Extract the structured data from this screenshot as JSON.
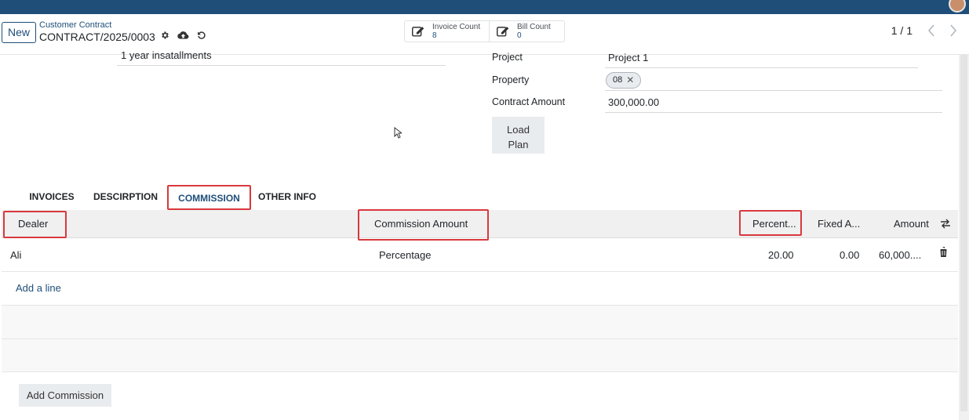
{
  "control_panel": {
    "new_label": "New",
    "breadcrumb_parent": "Customer Contract",
    "record_name": "CONTRACT/2025/0003",
    "smart_buttons": [
      {
        "label": "Invoice Count",
        "value": "8"
      },
      {
        "label": "Bill Count",
        "value": "0"
      }
    ],
    "pager": "1 / 1"
  },
  "form": {
    "terms_value": "1 year insatallments",
    "project_label": "Project",
    "project_value": "Project 1",
    "property_label": "Property",
    "property_tag": "08",
    "contract_amount_label": "Contract Amount",
    "contract_amount_value": "300,000.00",
    "load_plan_line1": "Load",
    "load_plan_line2": "Plan"
  },
  "tabs": [
    "INVOICES",
    "DESCIRPTION",
    "COMMISSION",
    "OTHER INFO"
  ],
  "active_tab": "COMMISSION",
  "table": {
    "columns": [
      "Dealer",
      "Commission Amount",
      "Percent...",
      "Fixed A...",
      "Amount"
    ],
    "rows": [
      {
        "dealer": "Ali",
        "commission_amount": "Percentage",
        "percent": "20.00",
        "fixed": "0.00",
        "amount": "60,000...."
      }
    ],
    "add_line": "Add a line"
  },
  "add_commission_label": "Add Commission",
  "colors": {
    "brand": "#1f4e79",
    "highlight": "#d9383e"
  }
}
